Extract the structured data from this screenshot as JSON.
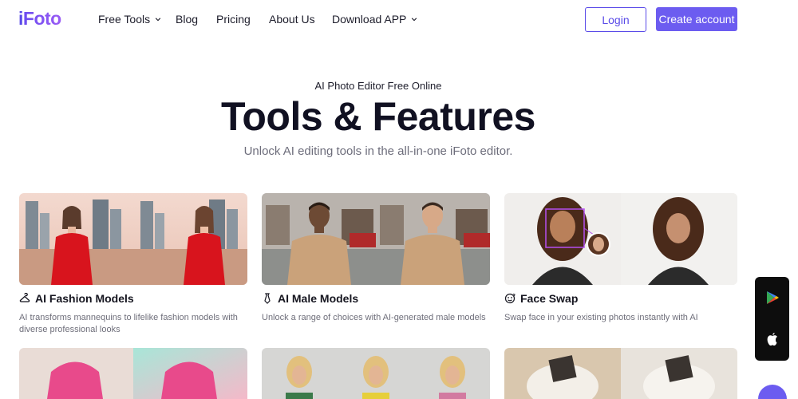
{
  "brand": {
    "logo_i": "i",
    "logo_rest": "Foto"
  },
  "nav": {
    "items": [
      {
        "label": "Free Tools",
        "has_dropdown": true
      },
      {
        "label": "Blog",
        "has_dropdown": false
      },
      {
        "label": "Pricing",
        "has_dropdown": false
      },
      {
        "label": "About Us",
        "has_dropdown": false
      },
      {
        "label": "Download APP",
        "has_dropdown": true
      }
    ],
    "login_label": "Login",
    "create_label": "Create account"
  },
  "hero": {
    "eyebrow": "AI Photo Editor Free Online",
    "title": "Tools & Features",
    "subtitle": "Unlock AI editing tools in the all-in-one iFoto editor."
  },
  "cards": [
    {
      "title": "AI Fashion Models",
      "icon": "hanger-icon",
      "description": "AI transforms mannequins to lifelike fashion models with diverse professional looks"
    },
    {
      "title": "AI Male Models",
      "icon": "tie-icon",
      "description": "Unlock a range of choices with AI-generated male models"
    },
    {
      "title": "Face Swap",
      "icon": "face-swap-icon",
      "description": "Swap face in your existing photos instantly with AI"
    }
  ],
  "side_dock": {
    "icons": [
      "google-play-icon",
      "apple-icon"
    ]
  },
  "colors": {
    "accent": "#6c5cf0",
    "accent_border": "#5a4be8",
    "dark": "#111122"
  }
}
